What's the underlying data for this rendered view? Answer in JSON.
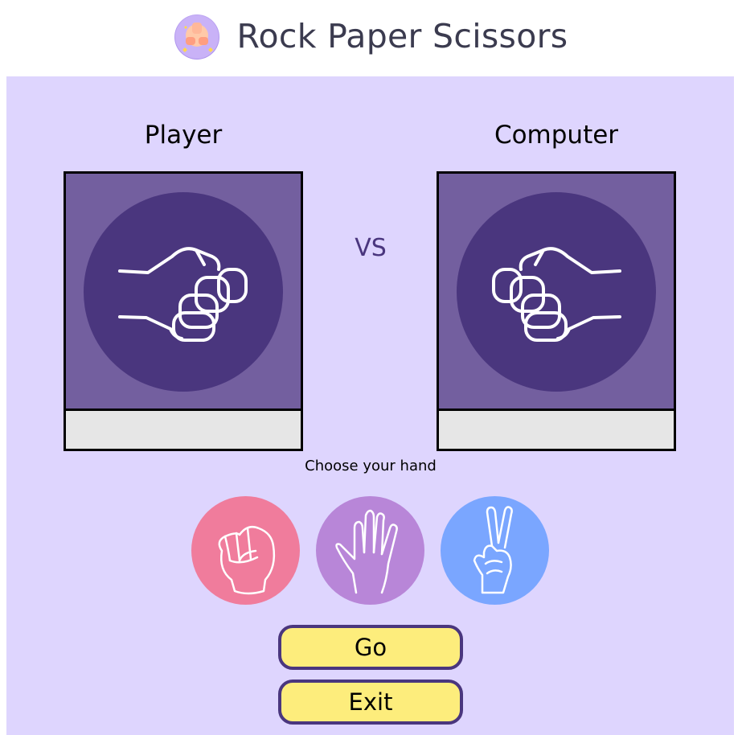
{
  "header": {
    "title": "Rock Paper Scissors",
    "logo_icon": "hands-logo-icon"
  },
  "game": {
    "player_label": "Player",
    "computer_label": "Computer",
    "vs_label": "VS",
    "player_hand_icon": "fist-icon",
    "computer_hand_icon": "fist-icon",
    "player_result": "",
    "computer_result": ""
  },
  "choices": {
    "prompt": "Choose your hand",
    "items": [
      {
        "name": "rock",
        "icon": "fist-icon",
        "color": "#f07c9c"
      },
      {
        "name": "paper",
        "icon": "open-hand-icon",
        "color": "#b886d8"
      },
      {
        "name": "scissors",
        "icon": "peace-hand-icon",
        "color": "#7aa6ff"
      }
    ]
  },
  "buttons": {
    "go_label": "Go",
    "exit_label": "Exit"
  },
  "colors": {
    "panel_bg": "#ded5fe",
    "card_bg": "#735f9f",
    "circle_bg": "#4a367e",
    "button_bg": "#fded7c",
    "button_border": "#4a367e"
  }
}
